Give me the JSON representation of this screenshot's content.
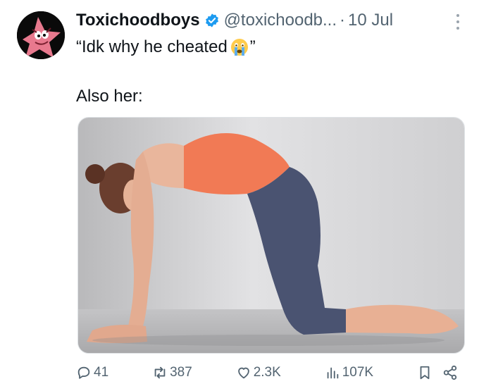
{
  "author": {
    "display_name": "Toxichoodboys",
    "handle": "@toxichoodb...",
    "separator": "·",
    "date": "10 Jul",
    "avatar_icon": "patrick-star-avatar"
  },
  "tweet": {
    "quote_open": "“Idk why he cheated",
    "emoji": "crying-face-emoji",
    "quote_close": "”",
    "line2": "Also her:"
  },
  "media": {
    "description_icon": "yoga-cat-pose-photo"
  },
  "actions": {
    "replies": "41",
    "retweets": "387",
    "likes": "2.3K",
    "views": "107K"
  },
  "colors": {
    "verified": "#1d9bf0",
    "muted": "#536471",
    "text": "#0f1419"
  }
}
